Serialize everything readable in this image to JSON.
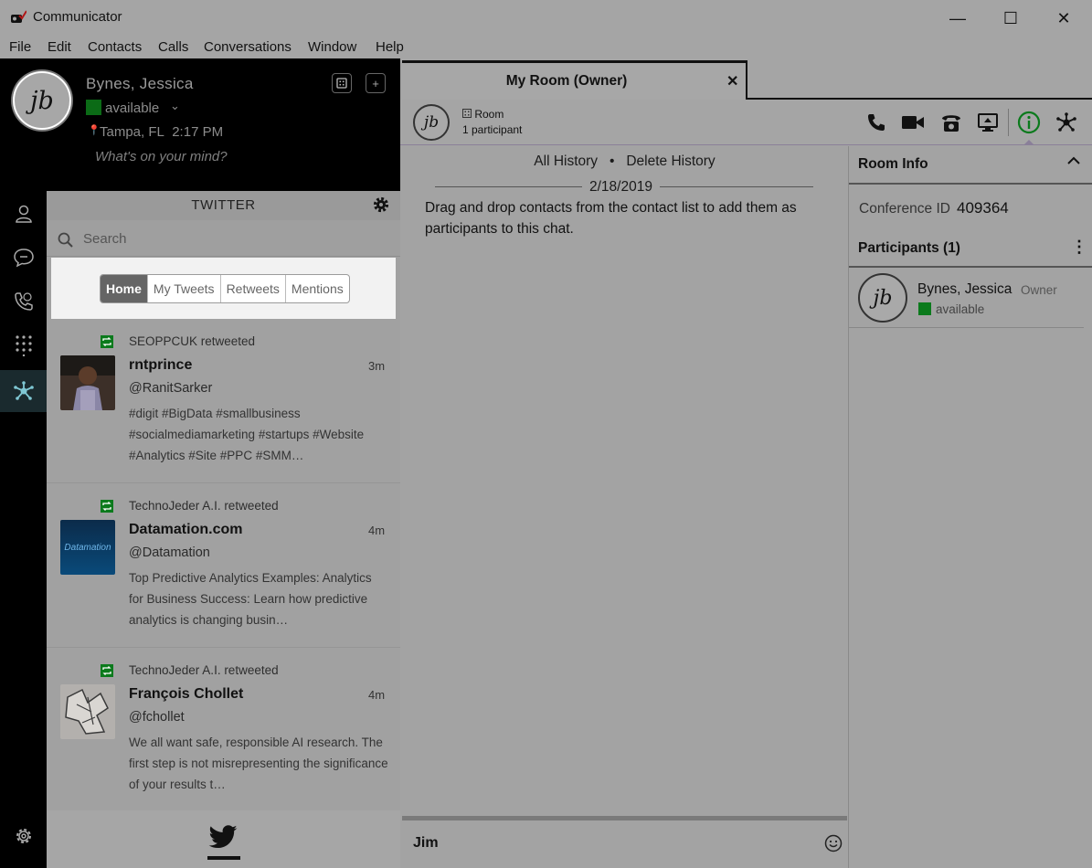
{
  "window": {
    "title": "Communicator",
    "minimize": "—",
    "maximize": "☐",
    "close": "✕"
  },
  "menu": [
    "File",
    "Edit",
    "Contacts",
    "Calls",
    "Conversations",
    "Window",
    "Help"
  ],
  "profile": {
    "initials": "jb",
    "name": "Bynes, Jessica",
    "presence": "available",
    "presence_color": "#0b6b16",
    "location": "Tampa, FL",
    "time": "2:17 PM",
    "status_prompt": "What's on your mind?"
  },
  "twitter": {
    "title": "TWITTER",
    "search_placeholder": "Search",
    "tabs": [
      "Home",
      "My Tweets",
      "Retweets",
      "Mentions"
    ],
    "active_tab": "Home",
    "tweets": [
      {
        "retweeted_by": "SEOPPCUK retweeted",
        "name": "rntprince",
        "handle": "@RanitSarker",
        "time": "3m",
        "text": "#digit #BigData #smallbusiness #socialmediamarketing #startups #Website #Analytics #Site #PPC #SMM…"
      },
      {
        "retweeted_by": "TechnoJeder A.I. retweeted",
        "name": "Datamation.com",
        "handle": "@Datamation",
        "time": "4m",
        "avatar_text": "Datamation",
        "text": "Top Predictive Analytics Examples: Analytics for Business Success: Learn how predictive analytics is changing busin…"
      },
      {
        "retweeted_by": "TechnoJeder A.I. retweeted",
        "name": "François Chollet",
        "handle": "@fchollet",
        "time": "4m",
        "text": "We all want safe, responsible AI research. The first step is not misrepresenting the significance of your results t…"
      }
    ],
    "retweet_color": "#0b7a1c"
  },
  "conversation": {
    "tab_title": "My Room (Owner)",
    "tab_close": "✕",
    "avatar_initials": "jb",
    "room_label": "Room",
    "participant_count": "1 participant",
    "all_history": "All History",
    "separator": "•",
    "delete_history": "Delete History",
    "date": "2/18/2019",
    "hint": "Drag and drop contacts from the contact list to add them as participants to this chat.",
    "compose_value": "Jim"
  },
  "room_info": {
    "title": "Room Info",
    "conference_label": "Conference ID",
    "conference_id": "409364",
    "participants_title": "Participants (1)",
    "participants": [
      {
        "initials": "jb",
        "name": "Bynes, Jessica",
        "role": "Owner",
        "status": "available"
      }
    ]
  },
  "accent_green": "#0b7a1c"
}
